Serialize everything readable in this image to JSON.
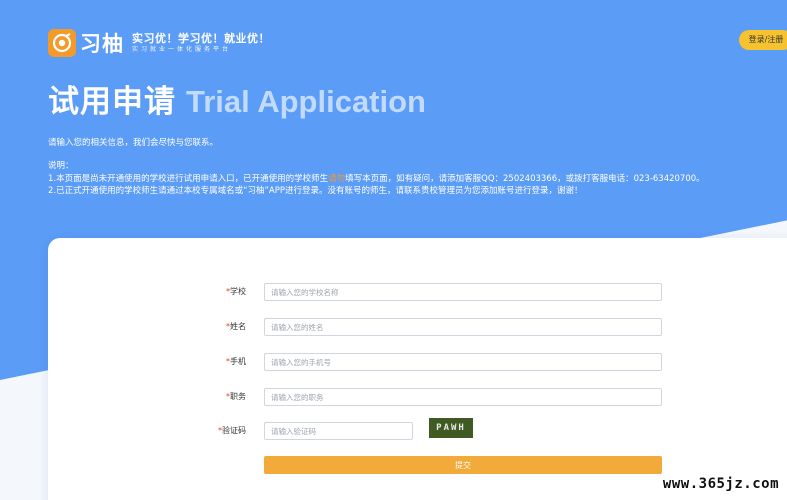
{
  "header": {
    "logo_name": "习柚",
    "slogan": "实习优！学习优！就业优！",
    "slogan_sub": "实习就业一体化服务平台",
    "login_label": "登录/注册"
  },
  "hero": {
    "title_cn": "试用申请",
    "title_en": "Trial Application",
    "intro": "请输入您的相关信息，我们会尽快与您联系。",
    "notes_heading": "说明：",
    "note1_part1": "1.本页面是尚未开通使用的学校进行试用申请入口，已开通使用的学校师生",
    "note1_highlight": "请勿",
    "note1_part2": "填写本页面，如有疑问，请添加客服QQ：2502403366，或拨打客服电话：023-63420700。",
    "note2": "2.已正式开通使用的学校师生请通过本校专属域名或“习柚”APP进行登录。没有账号的师生，请联系贵校管理员为您添加账号进行登录，谢谢！"
  },
  "form": {
    "required_mark": "*",
    "fields": [
      {
        "label": "学校",
        "placeholder": "请输入您的学校名称",
        "value": ""
      },
      {
        "label": "姓名",
        "placeholder": "请输入您的姓名",
        "value": ""
      },
      {
        "label": "手机",
        "placeholder": "请输入您的手机号",
        "value": ""
      },
      {
        "label": "职务",
        "placeholder": "请输入您的职务",
        "value": ""
      },
      {
        "label": "验证码",
        "placeholder": "请输入验证码",
        "value": ""
      }
    ],
    "captcha_text": "PAWH",
    "submit_label": "提交"
  },
  "watermark": "www.365jz.com"
}
